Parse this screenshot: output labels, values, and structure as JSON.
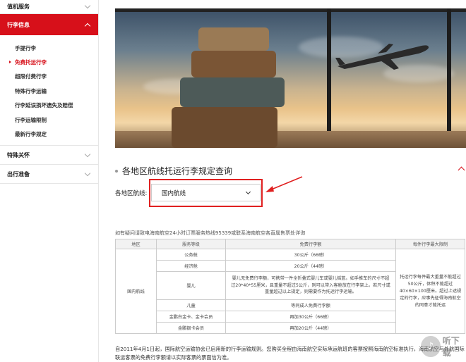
{
  "sidebar": {
    "top_item": "值机服务",
    "active_section": "行李信息",
    "sub_items": [
      "手提行李",
      "免费托运行李",
      "超限付费行李",
      "特殊行李运输",
      "行李延误损坏遗失及赔偿",
      "行李运输限制",
      "最新行李规定"
    ],
    "current_sub_index": 1,
    "bottom_items": [
      "特殊关怀",
      "出行准备"
    ]
  },
  "section": {
    "title": "各地区航线托运行李规定查询",
    "route_label": "各地区航线:",
    "route_selected": "国内航线"
  },
  "hint": "如有疑问请致电海南航空24小时订票服务热线95339或联系海南航空各直属售票处详询",
  "table": {
    "headers": [
      "地区",
      "服务等级",
      "免费行李额",
      "每件行李最大限制"
    ],
    "region": "国内航线",
    "rows": [
      {
        "class": "公务舱",
        "allowance": "30公斤（66磅）"
      },
      {
        "class": "经济舱",
        "allowance": "20公斤（44磅）"
      },
      {
        "class": "婴儿",
        "allowance": "婴儿无免费行李额，可携带一件全折叠式婴儿车或婴儿摇篮。如手推车的尺寸不超过20*40*55厘米，且重量不超过5公斤，则可以带入客舱放在行李架上。若尺寸或重量超过以上规定，则需要作为托运行李运输。"
      },
      {
        "class": "儿童",
        "allowance": "等同成人免费行李额"
      },
      {
        "class": "金鹏白金卡、金卡会员",
        "allowance": "再加30公斤（66磅）"
      },
      {
        "class": "金鹏银卡会员",
        "allowance": "再加20公斤（44磅）"
      }
    ],
    "max_note": "托运行李每件最大重量不能超过50公斤，体积不能超过40×60×100厘米。超过上述规定的行李，应事先征得海南航空的同意才能托运"
  },
  "footer": "自2011年4月1日起，国际航空运输协会已启用新的行李运输规则。您购买全程由海南航空实际承运航班的客票按照海南航空标准执行，海南航空与外航国际联运客票的免费行李额请以实际客票的票面信为准。",
  "watermark": "听下载",
  "colors": {
    "accent": "#d7101a",
    "annotation": "#e02020"
  },
  "icons": {
    "collapsed": "chevron-down-icon",
    "expanded": "chevron-up-icon",
    "dropdown": "chevron-down-icon",
    "pointer": "arrow-icon"
  }
}
